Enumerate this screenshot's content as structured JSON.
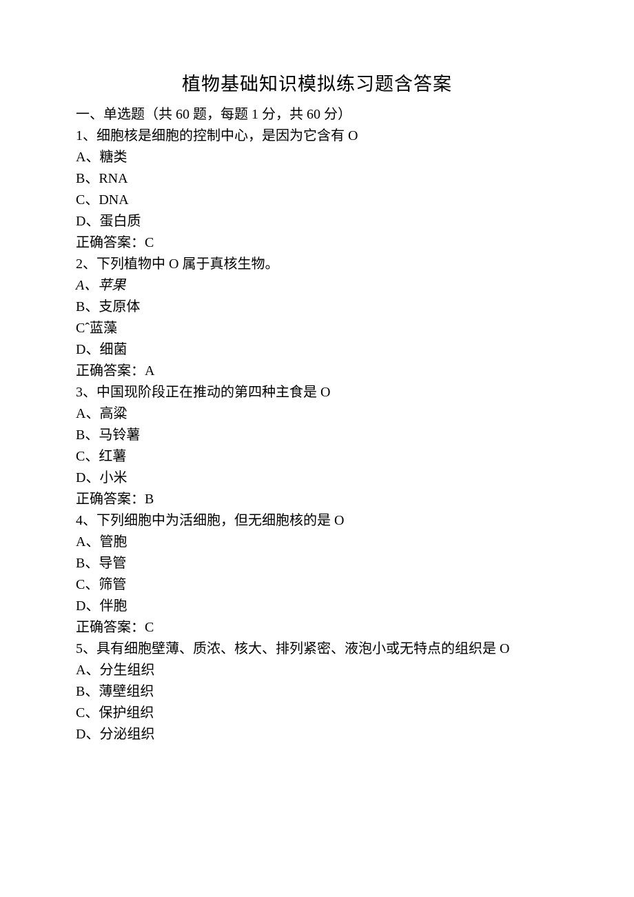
{
  "title": "植物基础知识模拟练习题含答案",
  "section_header": "一、单选题（共 60 题，每题 1 分，共 60 分）",
  "questions": [
    {
      "stem": "1、细胞核是细胞的控制中心，是因为它含有 O",
      "opts": [
        "A、糖类",
        "B、RNA",
        "C、DNA",
        "D、蛋白质"
      ],
      "answer": "正确答案：C"
    },
    {
      "stem": "2、下列植物中 O 属于真核生物。",
      "opts": [
        "A、苹果",
        "B、支原体",
        "Cˆ蓝藻",
        "D、细菌"
      ],
      "answer": "正确答案：A",
      "italicA": true
    },
    {
      "stem": "3、中国现阶段正在推动的第四种主食是 O",
      "opts": [
        "A、高粱",
        "B、马铃薯",
        "C、红薯",
        "D、小米"
      ],
      "answer": "正确答案：B"
    },
    {
      "stem": "4、下列细胞中为活细胞，但无细胞核的是 O",
      "opts": [
        "A、管胞",
        "B、导管",
        "C、筛管",
        "D、伴胞"
      ],
      "answer": "正确答案：C"
    },
    {
      "stem": "5、具有细胞壁薄、质浓、核大、排列紧密、液泡小或无特点的组织是 O",
      "opts": [
        "A、分生组织",
        "B、薄壁组织",
        "C、保护组织",
        "D、分泌组织"
      ],
      "answer": ""
    }
  ]
}
